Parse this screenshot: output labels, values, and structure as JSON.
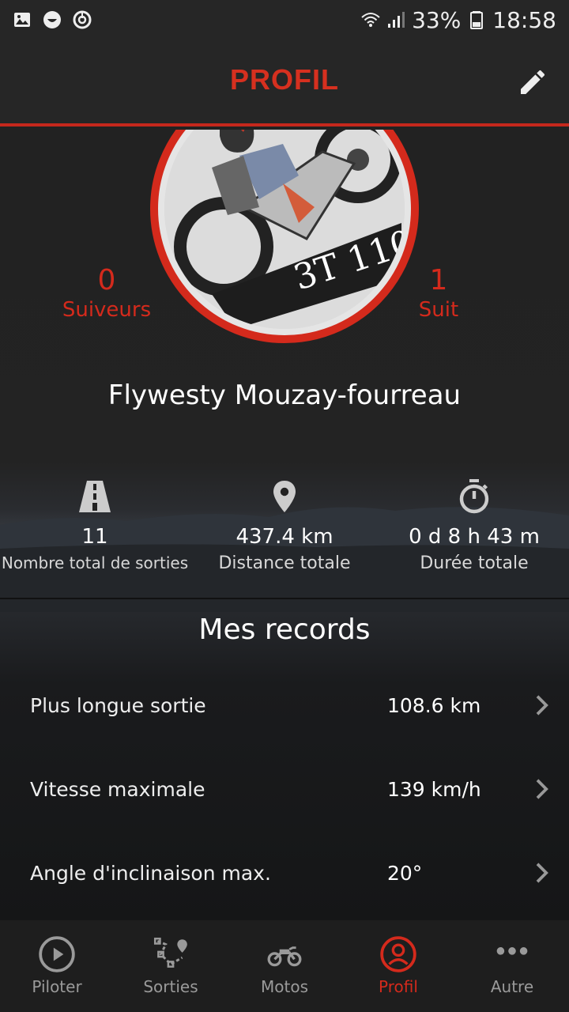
{
  "status_bar": {
    "battery": "33%",
    "time": "18:58"
  },
  "header": {
    "title": "PROFIL"
  },
  "profile": {
    "followers_count": "0",
    "followers_label": "Suiveurs",
    "following_count": "1",
    "following_label": "Suit",
    "username": "Flywesty Mouzay-fourreau"
  },
  "stats": [
    {
      "icon": "road-icon",
      "value": "11",
      "label": "Nombre total de sorties"
    },
    {
      "icon": "location-pin-icon",
      "value": "437.4 km",
      "label": "Distance totale"
    },
    {
      "icon": "stopwatch-icon",
      "value": "0 d 8 h 43 m",
      "label": "Durée totale"
    }
  ],
  "records": {
    "title": "Mes records",
    "items": [
      {
        "label": "Plus longue sortie",
        "value": "108.6 km"
      },
      {
        "label": "Vitesse maximale",
        "value": "139 km/h"
      },
      {
        "label": "Angle d'inclinaison max.",
        "value": "20°"
      }
    ]
  },
  "tabs": [
    {
      "icon": "play-icon",
      "label": "Piloter",
      "active": false
    },
    {
      "icon": "route-icon",
      "label": "Sorties",
      "active": false
    },
    {
      "icon": "motorcycle-icon",
      "label": "Motos",
      "active": false
    },
    {
      "icon": "profile-icon",
      "label": "Profil",
      "active": true
    },
    {
      "icon": "more-icon",
      "label": "Autre",
      "active": false
    }
  ],
  "colors": {
    "accent": "#d42a1c",
    "background": "#222222"
  }
}
